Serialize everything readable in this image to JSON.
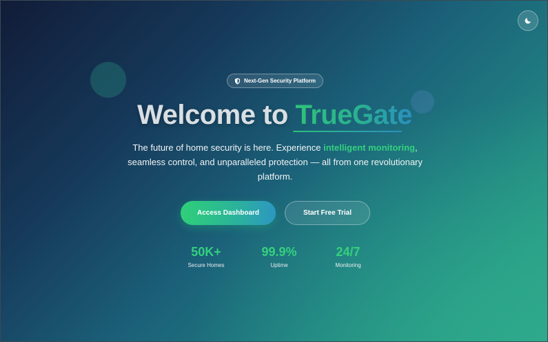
{
  "badge": {
    "label": "Next-Gen Security Platform",
    "icon": "shield-icon"
  },
  "hero": {
    "title_prefix": "Welcome to ",
    "title_brand": "TrueGate",
    "subtitle_before": "The future of home security is here. Experience ",
    "subtitle_highlight": "intelligent monitoring",
    "subtitle_after": ", seamless control, and unparalleled protection — all from one revolutionary platform."
  },
  "buttons": {
    "primary_label": "Access Dashboard",
    "secondary_label": "Start Free Trial"
  },
  "stats": [
    {
      "value": "50K+",
      "label": "Secure Homes"
    },
    {
      "value": "99.9%",
      "label": "Uptime"
    },
    {
      "value": "24/7",
      "label": "Monitoring"
    }
  ],
  "theme_toggle": {
    "icon": "moon-icon"
  },
  "colors": {
    "accent_green": "#35d07e",
    "accent_blue": "#2b8fc0",
    "background_dark": "#111c38",
    "background_teal": "#2ea58a"
  }
}
